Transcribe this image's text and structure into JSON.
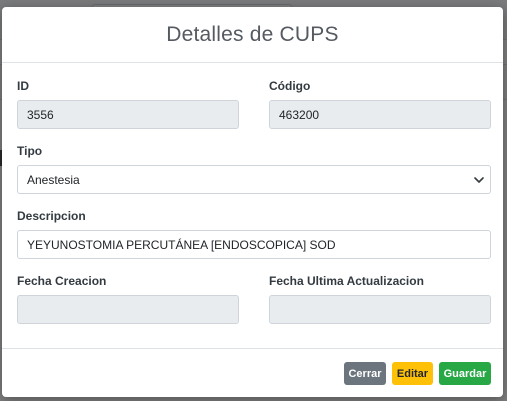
{
  "modal": {
    "title": "Detalles de CUPS",
    "fields": {
      "id": {
        "label": "ID",
        "value": "3556"
      },
      "codigo": {
        "label": "Código",
        "value": "463200"
      },
      "tipo": {
        "label": "Tipo",
        "value": "Anestesia"
      },
      "descripcion": {
        "label": "Descripcion",
        "value": "YEYUNOSTOMIA PERCUTÁNEA [ENDOSCOPICA] SOD"
      },
      "fecha_creacion": {
        "label": "Fecha Creacion",
        "value": ""
      },
      "fecha_ultima_actualizacion": {
        "label": "Fecha Ultima Actualizacion",
        "value": ""
      }
    },
    "footer": {
      "cerrar_label": "Cerrar",
      "editar_label": "Editar",
      "guardar_label": "Guardar"
    }
  },
  "colors": {
    "cerrar": "#6c757d",
    "editar": "#ffc107",
    "guardar": "#28a745",
    "readonly_bg": "#e9ecef"
  }
}
